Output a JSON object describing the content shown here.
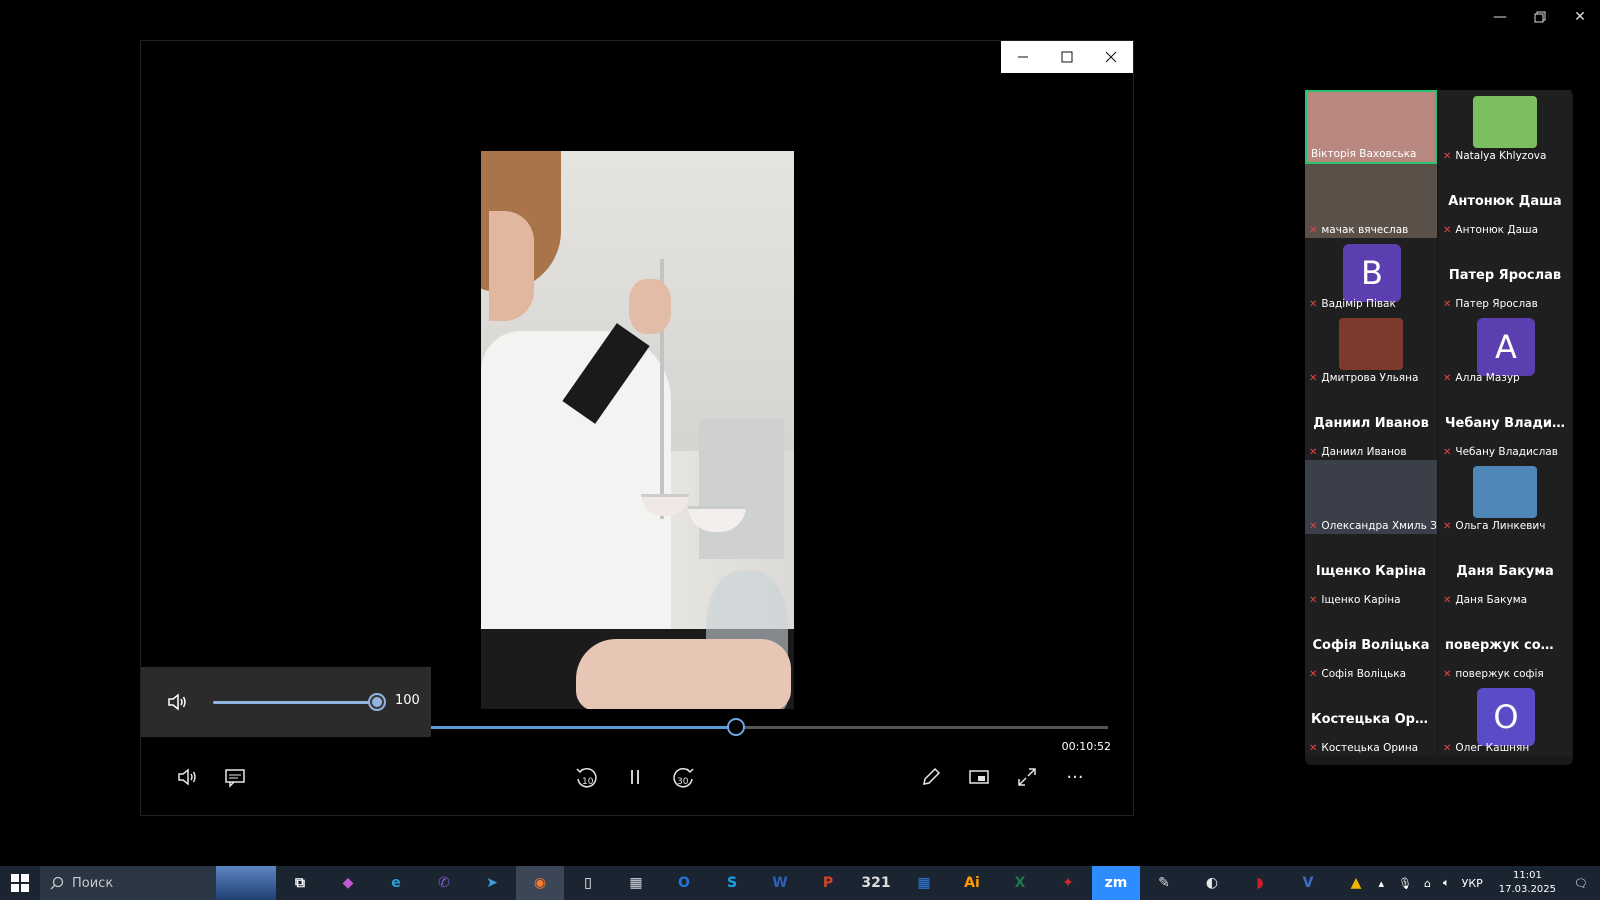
{
  "window": {
    "minimize": "—",
    "maximize": "▢",
    "close": "✕"
  },
  "player": {
    "volume": {
      "value": "100",
      "level": 1.0
    },
    "seek": {
      "time": "00:10:52",
      "progress": 0.45
    },
    "controls": {
      "volume_icon": "speaker-icon",
      "subtitles_icon": "subtitles-icon",
      "rewind_label": "10",
      "forward_label": "30",
      "pause_icon": "pause-icon",
      "edit_icon": "pencil-icon",
      "miniplayer_icon": "miniplayer-icon",
      "fullscreen_icon": "fullscreen-icon",
      "more_label": "···"
    }
  },
  "participants": [
    {
      "name": "Вікторія Ваховська",
      "type": "photo",
      "active": true,
      "color": "#b78780"
    },
    {
      "name": "Natalya Khlyzova",
      "type": "photo",
      "color": "#7cbf5f"
    },
    {
      "name": "мачак вячеслав",
      "type": "photo",
      "color": "#5b5048"
    },
    {
      "name": "Антонюк Даша",
      "type": "name",
      "big": "Антонюк Даша"
    },
    {
      "name": "Вадімір Півак",
      "type": "avatar",
      "letter": "В",
      "color": "#5b3fb0"
    },
    {
      "name": "Патер Ярослав",
      "type": "name",
      "big": "Патер Ярослав"
    },
    {
      "name": "Дмитрова Ульяна",
      "type": "photo",
      "color": "#7a3b2c"
    },
    {
      "name": "Алла Мазур",
      "type": "avatar",
      "letter": "А",
      "color": "#5b3fb0"
    },
    {
      "name": "Даниил Иванов",
      "type": "name",
      "big": "Даниил Иванов"
    },
    {
      "name": "Чебану Владислав",
      "type": "name",
      "big": "Чебану Владис..."
    },
    {
      "name": "Олександра Хмиль З...",
      "type": "photo",
      "color": "#3a3f4a"
    },
    {
      "name": "Ольга Линкевич",
      "type": "photo",
      "color": "#4f87b8"
    },
    {
      "name": "Іщенко Каріна",
      "type": "name",
      "big": "Іщенко Каріна"
    },
    {
      "name": "Даня Бакума",
      "type": "name",
      "big": "Даня Бакума"
    },
    {
      "name": "Софія Воліцька",
      "type": "name",
      "big": "Софія Воліцька"
    },
    {
      "name": "повержук софія",
      "type": "name",
      "big": "повержук софія"
    },
    {
      "name": "Костецька Орина",
      "type": "name",
      "big": "Костецька Орина"
    },
    {
      "name": "Олег Кашнян",
      "type": "avatar",
      "letter": "О",
      "color": "#5a4cc7"
    }
  ],
  "taskbar": {
    "search_placeholder": "Поиск",
    "apps": [
      {
        "label": "",
        "icon": "app-thumbnail-icon",
        "color": "#4b6fa8"
      },
      {
        "label": "⧉",
        "icon": "task-view-icon",
        "color": "#ffffff"
      },
      {
        "label": "◆",
        "icon": "copilot-icon",
        "color": "#c25cd4"
      },
      {
        "label": "e",
        "icon": "edge-icon",
        "color": "#2aa0d8"
      },
      {
        "label": "✆",
        "icon": "viber-icon",
        "color": "#7d5bd0"
      },
      {
        "label": "➤",
        "icon": "telegram-icon",
        "color": "#3aa5dd"
      },
      {
        "label": "◉",
        "icon": "firefox-icon",
        "color": "#ff7a2a"
      },
      {
        "label": "▯",
        "icon": "file-icon",
        "color": "#ffffff"
      },
      {
        "label": "▦",
        "icon": "calculator-icon",
        "color": "#cfd6df"
      },
      {
        "label": "O",
        "icon": "outlook-icon",
        "color": "#1f78d1"
      },
      {
        "label": "S",
        "icon": "skype-icon",
        "color": "#1ea0e6"
      },
      {
        "label": "W",
        "icon": "word-icon",
        "color": "#2b5fb8"
      },
      {
        "label": "P",
        "icon": "powerpoint-icon",
        "color": "#d24726"
      },
      {
        "label": "321",
        "icon": "media-player-classic-icon",
        "color": "#dddddd"
      },
      {
        "label": "▦",
        "icon": "calendar-icon",
        "color": "#2d7fe0"
      },
      {
        "label": "Ai",
        "icon": "illustrator-icon",
        "color": "#ff9a00"
      },
      {
        "label": "X",
        "icon": "excel-icon",
        "color": "#1e7a45"
      },
      {
        "label": "✦",
        "icon": "red-app-icon",
        "color": "#d12a2a"
      },
      {
        "label": "zm",
        "icon": "zoom-icon",
        "color": "#2d8cff"
      },
      {
        "label": "✎",
        "icon": "scanner-icon",
        "color": "#dddddd"
      },
      {
        "label": "◐",
        "icon": "paint-icon",
        "color": "#e8e8e8"
      },
      {
        "label": "◗",
        "icon": "opera-icon",
        "color": "#d01b2a"
      },
      {
        "label": "V",
        "icon": "visio-icon",
        "color": "#3a6fc9"
      },
      {
        "label": "▲",
        "icon": "google-drive-icon",
        "color": "#f4b400"
      }
    ],
    "tray": {
      "lang": "УКР",
      "time": "11:01",
      "date": "17.03.2025"
    }
  }
}
